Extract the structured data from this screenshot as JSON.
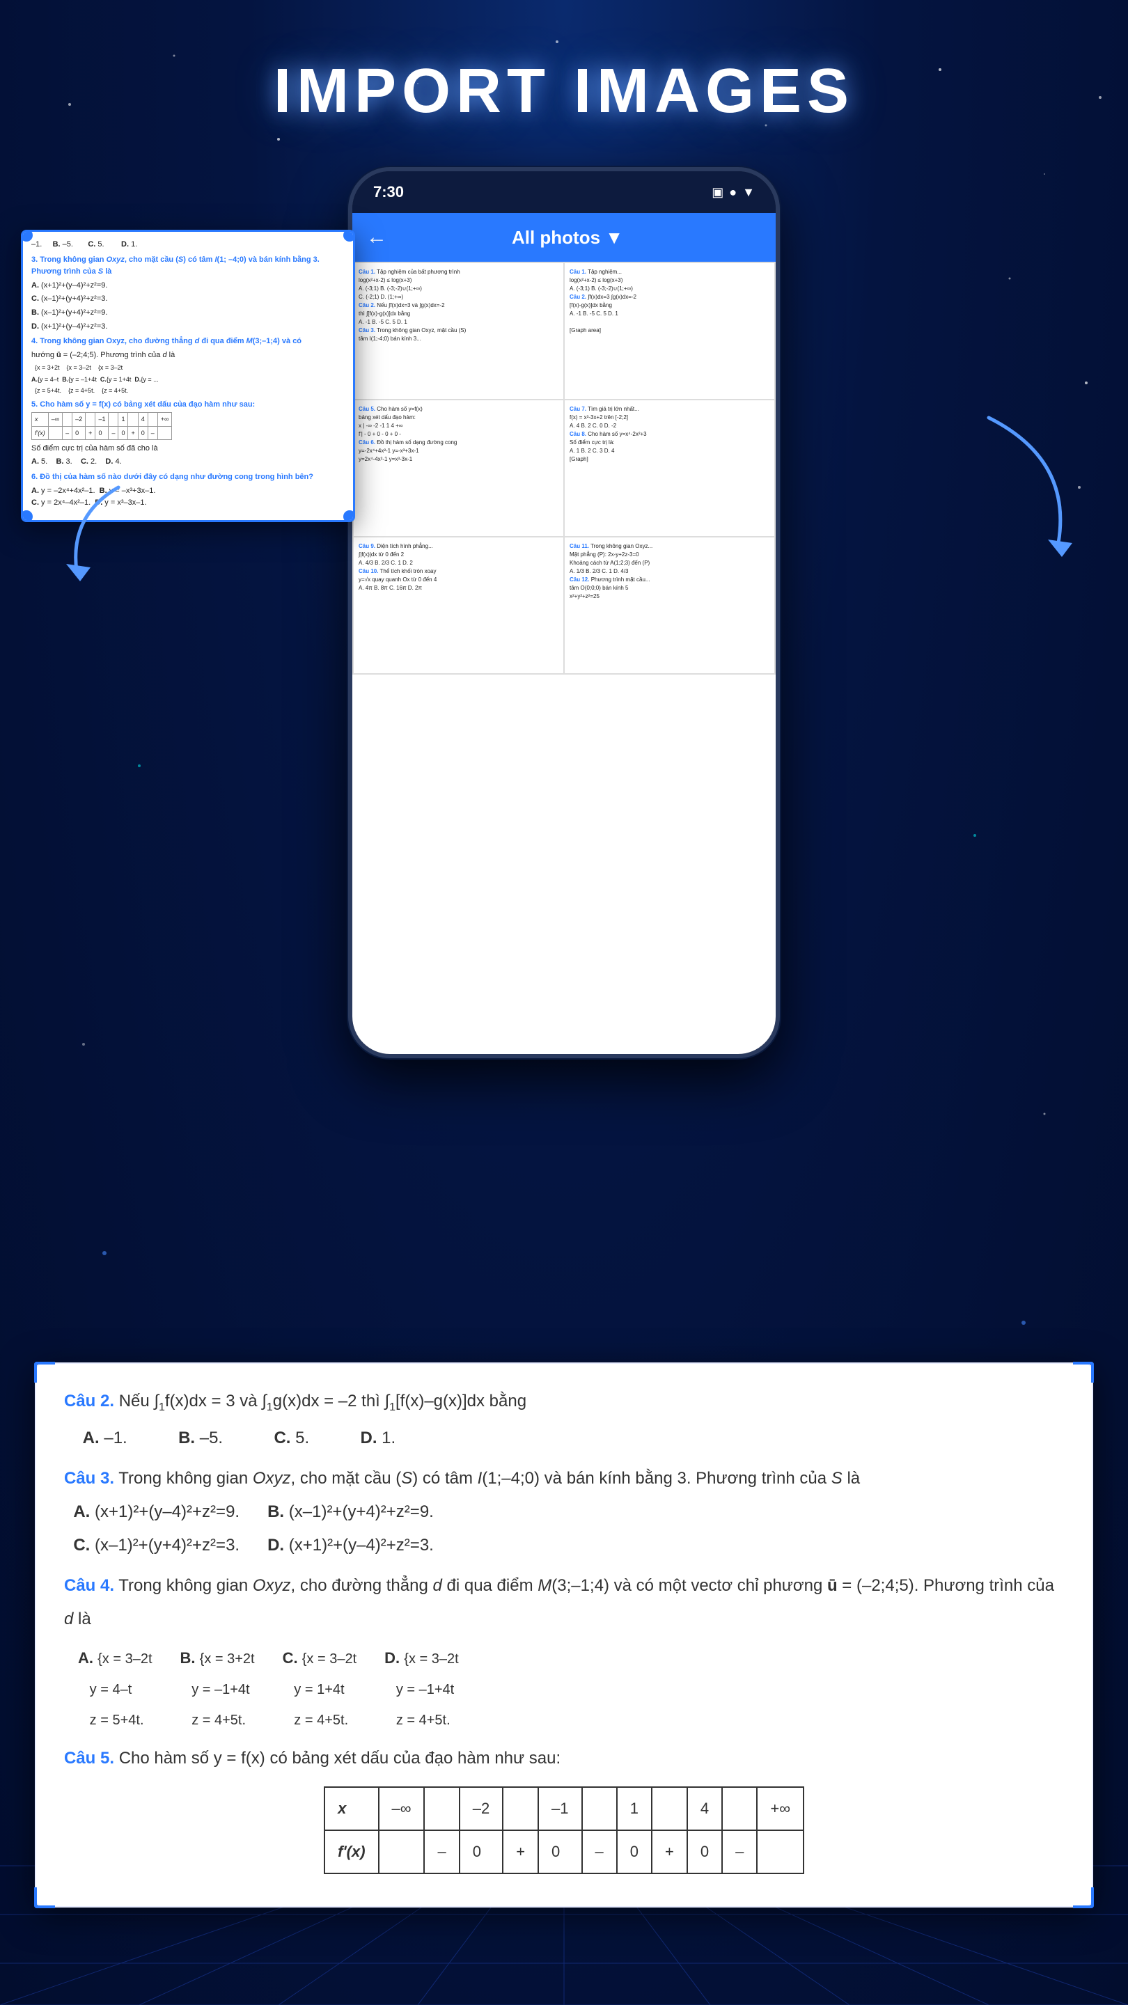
{
  "page": {
    "title": "IMPORT IMAGES",
    "background_color": "#041440"
  },
  "phone": {
    "time": "7:30",
    "status_icons": [
      "▣",
      "●",
      "▼"
    ]
  },
  "appbar": {
    "title": "All photos",
    "dropdown_icon": "▼",
    "back_icon": "←"
  },
  "zoom_card": {
    "lines": [
      "-1.       B. -5.         C. 5.          D. 1.",
      "3. Trong không gian Oxyz, cho mặt cầu (S) có tâm I(1; -4;0) và bán kính bằng 3. Phương trình của S là",
      "(x+1)² + (y-4)² + z² = 9.",
      "(x-1)² + (y+4)² + z² = 3.",
      "(x-1)² + (y+4)² + z² = 9.",
      "(x+1)² + (y-4)² + z² = 3.",
      "4. Trong không gian Oxyz, cho đường thẳng d đi qua điểm M(3;-1;4) và có",
      "hướng ū = (-2;4;5). Phương trình của d là",
      "x = 3+2t       x = 3-2t       x = 3-2t",
      "y = 4-t    B.  y = -1+4t  C.  y = 1+4t   D. y = ...",
      "z = 5+4t.      z = 4+5t.      z = 4+5t.",
      "5. Cho hàm số y = f(x) có bảng xét dấu của đạo hàm như sau:",
      "Số điểm cực trị của hàm số đã cho là",
      "5.     B. 3.     C. 2.     D. 4.",
      "6. Đồ thị của hàm số nào dưới đây có dạng như đường cong trong hình bên?",
      "y = -2x⁴ + 4x² - 1.   B. y = -x³ + 3x - 1.",
      "y = 2x⁴ - 4x² - 1.    D. y = x³ - 3x - 1."
    ]
  },
  "extracted_card": {
    "lines": [
      {
        "label": "Câu 2.",
        "text": "Nếu ∫f(x)dx = 3 và ∫g(x)dx = -2 thì ∫[f(x)-g(x)]dx bằng"
      },
      {
        "label": "",
        "text": "A. -1.          B. -5.          C. 5.          D. 1."
      },
      {
        "label": "Câu 3.",
        "text": "Trong không gian Oxyz, cho mặt cầu (S) có tâm I(1;-4;0) và bán kính bằng 3. Phương trình của S là"
      },
      {
        "label": "",
        "text": "A. (x+1)² + (y-4)² + z² = 9.      B. (x-1)² + (y+4)² + z² = 9."
      },
      {
        "label": "",
        "text": "C. (x-1)² + (y+4)² + z² = 3.      D. (x+1)² + (y-4)² + z² = 3."
      },
      {
        "label": "Câu 4.",
        "text": "Trong không gian Oxyz, cho đường thẳng d đi qua điểm M(3;-1;4) và có một vectơ chỉ phương ū = (-2;4;5). Phương trình của d là"
      },
      {
        "label": "Câu 5.",
        "text": "Cho hàm số y = f(x) có bảng xét dấu của đạo hàm như sau:"
      }
    ],
    "table": {
      "headers": [
        "x",
        "-∞",
        "",
        "-2",
        "",
        "-1",
        "",
        "1",
        "",
        "4",
        "",
        "+∞"
      ],
      "row": [
        "f'(x)",
        "",
        "-",
        "",
        "0",
        "",
        "+",
        "",
        "0",
        "",
        "-",
        "",
        "0",
        "",
        "+",
        "",
        "0",
        "",
        "-"
      ]
    }
  }
}
